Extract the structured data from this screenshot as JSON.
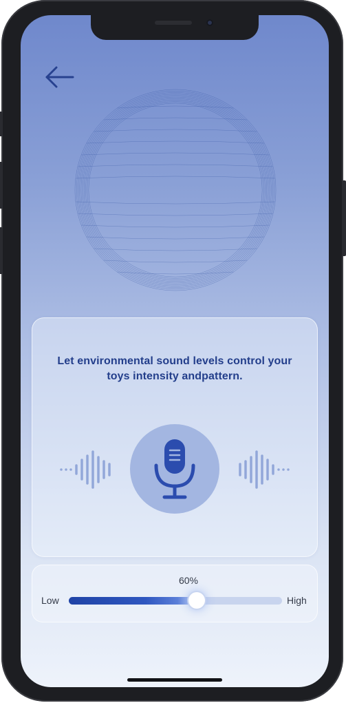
{
  "header": {
    "back_icon": "arrow-left-icon"
  },
  "visualizer": {
    "icon": "sound-wave-sphere-icon"
  },
  "card": {
    "headline": "Let environmental sound levels control your toys intensity andpattern.",
    "mic_icon": "microphone-icon",
    "left_bars_icon": "sound-level-bars-icon",
    "right_bars_icon": "sound-level-bars-icon"
  },
  "intensity": {
    "percent_label": "60%",
    "value": 0.6,
    "low_label": "Low",
    "high_label": "High"
  },
  "colors": {
    "accent": "#2f57c0",
    "headline": "#233e8b",
    "mic": "#2b4cae",
    "wave": "#2f4f9f"
  }
}
